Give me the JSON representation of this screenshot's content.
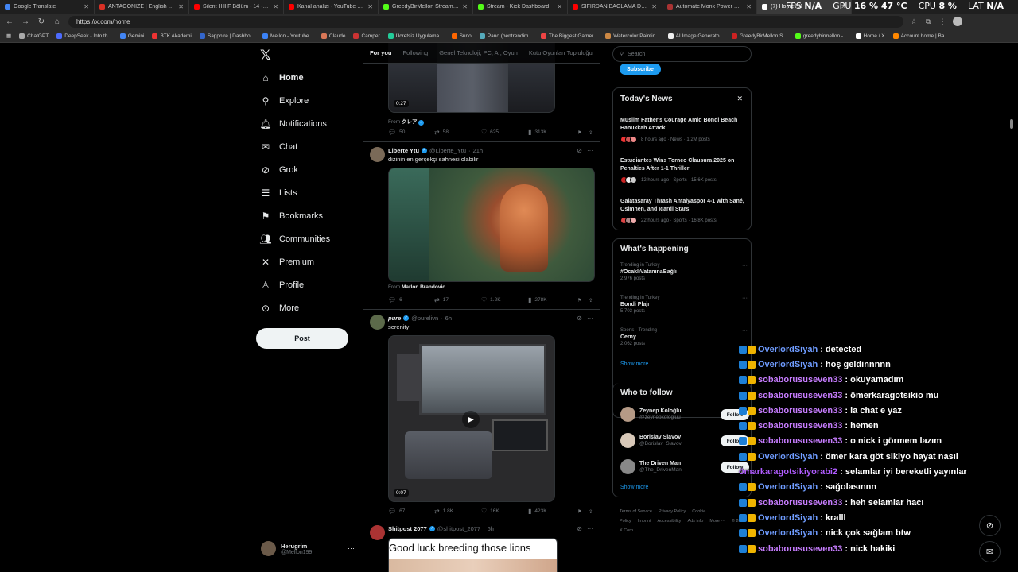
{
  "browser": {
    "tabs": [
      {
        "label": "Google Translate",
        "color": "#4285f4",
        "active": false
      },
      {
        "label": "ANTAGONIZE | English meaning",
        "color": "#d93025",
        "active": false
      },
      {
        "label": "Silent Hill F Bölüm - 14 - \"Uyuşturucu...",
        "color": "#ff0000",
        "active": false
      },
      {
        "label": "Kanal analizi - YouTube Studio",
        "color": "#ff0000",
        "active": false
      },
      {
        "label": "GreedyBirMellon Stream - Watch...",
        "color": "#53fc18",
        "active": false
      },
      {
        "label": "Stream - Kick Dashboard",
        "color": "#53fc18",
        "active": false
      },
      {
        "label": "SIFIRDAN BAĞLAMA DERSİ 3 (EN...",
        "color": "#ff0000",
        "active": false
      },
      {
        "label": "Automate Monk Power Charges W...",
        "color": "#a33",
        "active": false
      },
      {
        "label": "(7) Home / X",
        "color": "#ffffff",
        "active": true
      }
    ],
    "perf": {
      "fps_label": "FPS",
      "fps": "N/A",
      "gpu_label": "GPU",
      "gpu": "16 % 47 °C",
      "cpu_label": "CPU",
      "cpu": "8 %",
      "lat_label": "LAT",
      "lat": "N/A"
    },
    "url": "https://x.com/home",
    "bookmarks": [
      {
        "label": "ChatGPT",
        "color": "#aaa"
      },
      {
        "label": "DeepSeek - Into th...",
        "color": "#4d6bfe"
      },
      {
        "label": "Gemini",
        "color": "#4285f4"
      },
      {
        "label": "BTK Akademi",
        "color": "#e33"
      },
      {
        "label": "Sapphire | Dashbo...",
        "color": "#36c"
      },
      {
        "label": "Mellon - Youtube...",
        "color": "#3b82f6"
      },
      {
        "label": "Claude",
        "color": "#d97757"
      },
      {
        "label": "Camper",
        "color": "#c33"
      },
      {
        "label": "Ücretsiz Uygulama...",
        "color": "#2c9"
      },
      {
        "label": "Suno",
        "color": "#f60"
      },
      {
        "label": "Pano (bentrendim...",
        "color": "#5ab"
      },
      {
        "label": "The Biggest Gamer...",
        "color": "#e44"
      },
      {
        "label": "Watercolor Paintin...",
        "color": "#c84"
      },
      {
        "label": "AI Image Generato...",
        "color": "#eee"
      },
      {
        "label": "GreedyBirMellon S...",
        "color": "#c22"
      },
      {
        "label": "greedybirmellon -...",
        "color": "#53fc18"
      },
      {
        "label": "Home / X",
        "color": "#fff"
      },
      {
        "label": "Account home | Ba...",
        "color": "#f80"
      }
    ]
  },
  "nav": {
    "items": [
      {
        "label": "Home",
        "icon": "home-icon",
        "glyph": "⌂"
      },
      {
        "label": "Explore",
        "icon": "search-icon",
        "glyph": "⚲"
      },
      {
        "label": "Notifications",
        "icon": "bell-icon",
        "glyph": "🔔︎"
      },
      {
        "label": "Chat",
        "icon": "mail-icon",
        "glyph": "✉"
      },
      {
        "label": "Grok",
        "icon": "grok-icon",
        "glyph": "⊘"
      },
      {
        "label": "Lists",
        "icon": "list-icon",
        "glyph": "☰"
      },
      {
        "label": "Bookmarks",
        "icon": "bookmark-icon",
        "glyph": "⚑"
      },
      {
        "label": "Communities",
        "icon": "people-icon",
        "glyph": "👥︎"
      },
      {
        "label": "Premium",
        "icon": "x-icon",
        "glyph": "✕"
      },
      {
        "label": "Profile",
        "icon": "person-icon",
        "glyph": "♙"
      },
      {
        "label": "More",
        "icon": "more-circle-icon",
        "glyph": "⊙"
      }
    ],
    "post_label": "Post",
    "account": {
      "name": "Herugrim",
      "handle": "@Mellon199"
    }
  },
  "feed": {
    "tabs": [
      "For you",
      "Following",
      "Genel Teknoloji, PC, AI, Oyun",
      "Kutu Oyunları Topluluğu"
    ],
    "post0": {
      "duration": "0:27",
      "from_prefix": "From",
      "from_name": "クレア",
      "replies": "50",
      "reposts": "58",
      "likes": "625",
      "views": "313K"
    },
    "post1": {
      "name": "Liberte Ytü",
      "handle": "@Liberte_Ytu",
      "time": "21h",
      "text": "dizinin en gerçekçi sahnesi olabilir",
      "from_prefix": "From",
      "from_name": "Marlon Brandovic",
      "replies": "6",
      "reposts": "17",
      "likes": "1.2K",
      "views": "278K"
    },
    "post2": {
      "name": "pure",
      "handle": "@purelivn",
      "time": "6h",
      "text": "serenity",
      "duration": "0:07",
      "replies": "67",
      "reposts": "1.8K",
      "likes": "16K",
      "views": "423K"
    },
    "post3": {
      "name": "Shitpost 2077",
      "handle": "@shitpost_2077",
      "time": "6h",
      "image_text": "Good luck breeding those lions"
    }
  },
  "right": {
    "search_placeholder": "Search",
    "subscribe_label": "Subscribe",
    "news_title": "Today's News",
    "news": [
      {
        "title": "Muslim Father's Courage Amid Bondi Beach Hanukkah Attack",
        "meta": "8 hours ago · News · 1.2M posts"
      },
      {
        "title": "Estudiantes Wins Torneo Clausura 2025 on Penalties After 1-1 Thriller",
        "meta": "12 hours ago · Sports · 15.6K posts"
      },
      {
        "title": "Galatasaray Thrash Antalyaspor 4-1 with Sané, Osimhen, and Icardi Stars",
        "meta": "22 hours ago · Sports · 16.8K posts"
      }
    ],
    "happening_title": "What's happening",
    "trends": [
      {
        "context": "Trending in Turkey",
        "name": "#OcaklıVatanınaBağlı",
        "posts": "2,976 posts"
      },
      {
        "context": "Trending in Turkey",
        "name": "Bondi Plajı",
        "posts": "5,703 posts"
      },
      {
        "context": "Sports · Trending",
        "name": "Cerny",
        "posts": "2,062 posts"
      }
    ],
    "show_more": "Show more",
    "wtf_title": "Who to follow",
    "follow_label": "Follow",
    "who_to_follow": [
      {
        "name": "Zeynep Koloğlu",
        "handle": "@zeynepkologluu"
      },
      {
        "name": "Borislav Slavov",
        "handle": "@Borislav_Slavov"
      },
      {
        "name": "The Driven Man",
        "handle": "@The_DrivenMan"
      }
    ],
    "footer": [
      "Terms of Service",
      "Privacy Policy",
      "Cookie Policy",
      "Imprint",
      "Accessibility",
      "Ads info",
      "More ···",
      "© 2025 X Corp."
    ]
  },
  "chat": [
    {
      "user": "OverlordSiyah",
      "color": "#6f9cff",
      "msg": ": detected"
    },
    {
      "user": "OverlordSiyah",
      "color": "#6f9cff",
      "msg": ": hoş geldinnnnn"
    },
    {
      "user": "sobaborususeven33",
      "color": "#c77dff",
      "msg": ": okuyamadım"
    },
    {
      "user": "sobaborususeven33",
      "color": "#c77dff",
      "msg": ": ömerkaragotsikio mu"
    },
    {
      "user": "sobaborususeven33",
      "color": "#c77dff",
      "msg": ": la chat e yaz"
    },
    {
      "user": "sobaborususeven33",
      "color": "#c77dff",
      "msg": ": hemen"
    },
    {
      "user": "sobaborususeven33",
      "color": "#c77dff",
      "msg": ": o nick i görmem lazım"
    },
    {
      "user": "OverlordSiyah",
      "color": "#6f9cff",
      "msg": ": ömer kara göt sikiyo hayat nasıl"
    },
    {
      "user": "ömarkaragotsikiyorabi2",
      "color": "#b05cff",
      "msg": ": selamlar iyi bereketli yayınlar",
      "nobadge": true
    },
    {
      "user": "OverlordSiyah",
      "color": "#6f9cff",
      "msg": ": sağolasınnn"
    },
    {
      "user": "sobaborususeven33",
      "color": "#c77dff",
      "msg": ": heh selamlar hacı"
    },
    {
      "user": "OverlordSiyah",
      "color": "#6f9cff",
      "msg": ": kralll"
    },
    {
      "user": "OverlordSiyah",
      "color": "#6f9cff",
      "msg": ": nick çok sağlam btw"
    },
    {
      "user": "sobaborususeven33",
      "color": "#c77dff",
      "msg": ": nick hakiki"
    }
  ]
}
